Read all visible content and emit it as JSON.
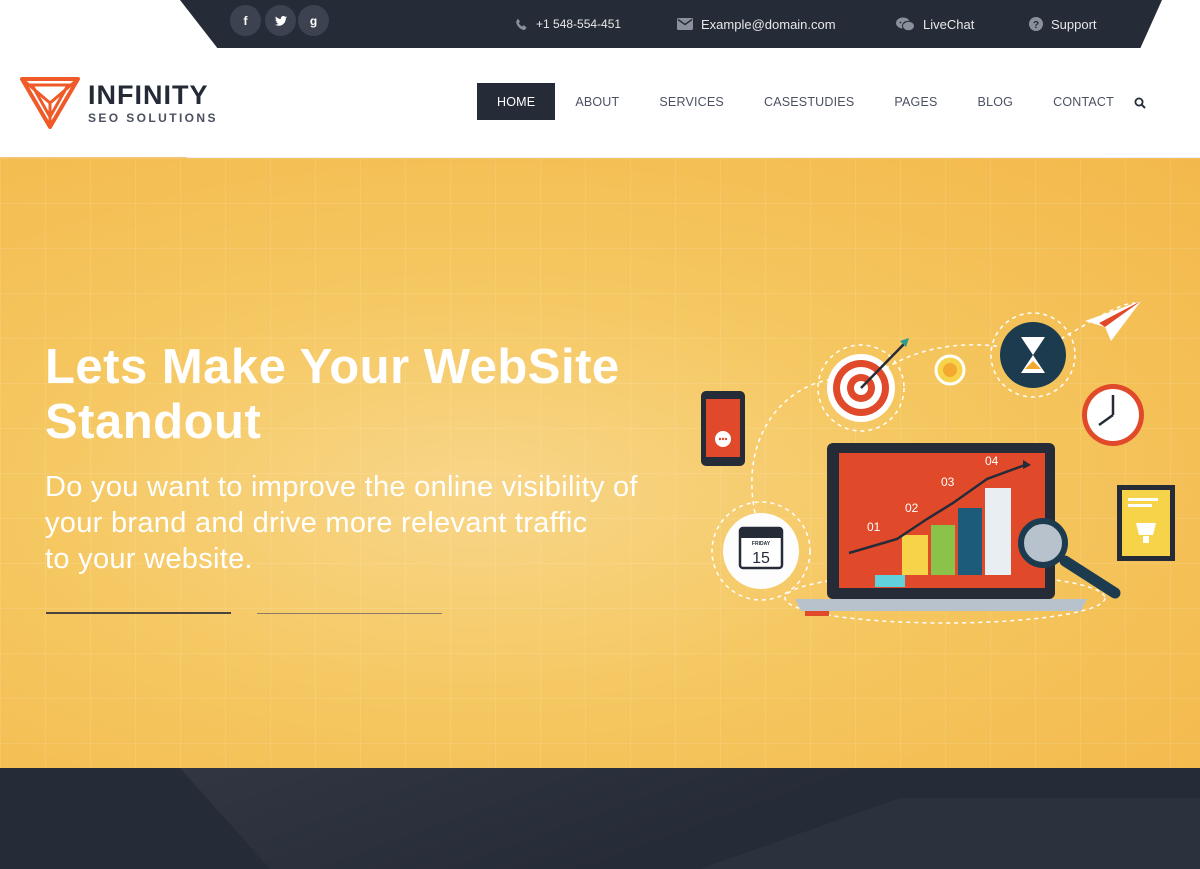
{
  "topbar": {
    "social": [
      {
        "name": "facebook",
        "glyph": "f"
      },
      {
        "name": "twitter",
        "glyph": "t"
      },
      {
        "name": "google-plus",
        "glyph": "g"
      }
    ],
    "phone": "+1 548-554-451",
    "email": "Example@domain.com",
    "livechat": "LiveChat",
    "support": "Support"
  },
  "logo": {
    "name": "INFINITY",
    "tagline": "SEO SOLUTIONS",
    "brand_color": "#f05a28",
    "dark_color": "#242a36"
  },
  "nav": {
    "items": [
      "HOME",
      "ABOUT",
      "SERVICES",
      "CASESTUDIES",
      "PAGES",
      "BLOG",
      "CONTACT"
    ],
    "active": "HOME"
  },
  "hero": {
    "title_line1": "Lets Make Your WebSite",
    "title_line2": "Standout",
    "subtitle_line1": "Do you want to improve the online visibility of",
    "subtitle_line2": "your brand and drive more relevant traffic",
    "subtitle_line3": "to your website.",
    "illustration": {
      "chart_labels": [
        "01",
        "02",
        "03",
        "04"
      ],
      "calendar_day": "FRIDAY",
      "calendar_date": "15"
    },
    "bg_color": "#f5c760"
  },
  "colors": {
    "dark": "#262b38",
    "accent": "#f2c27a"
  }
}
